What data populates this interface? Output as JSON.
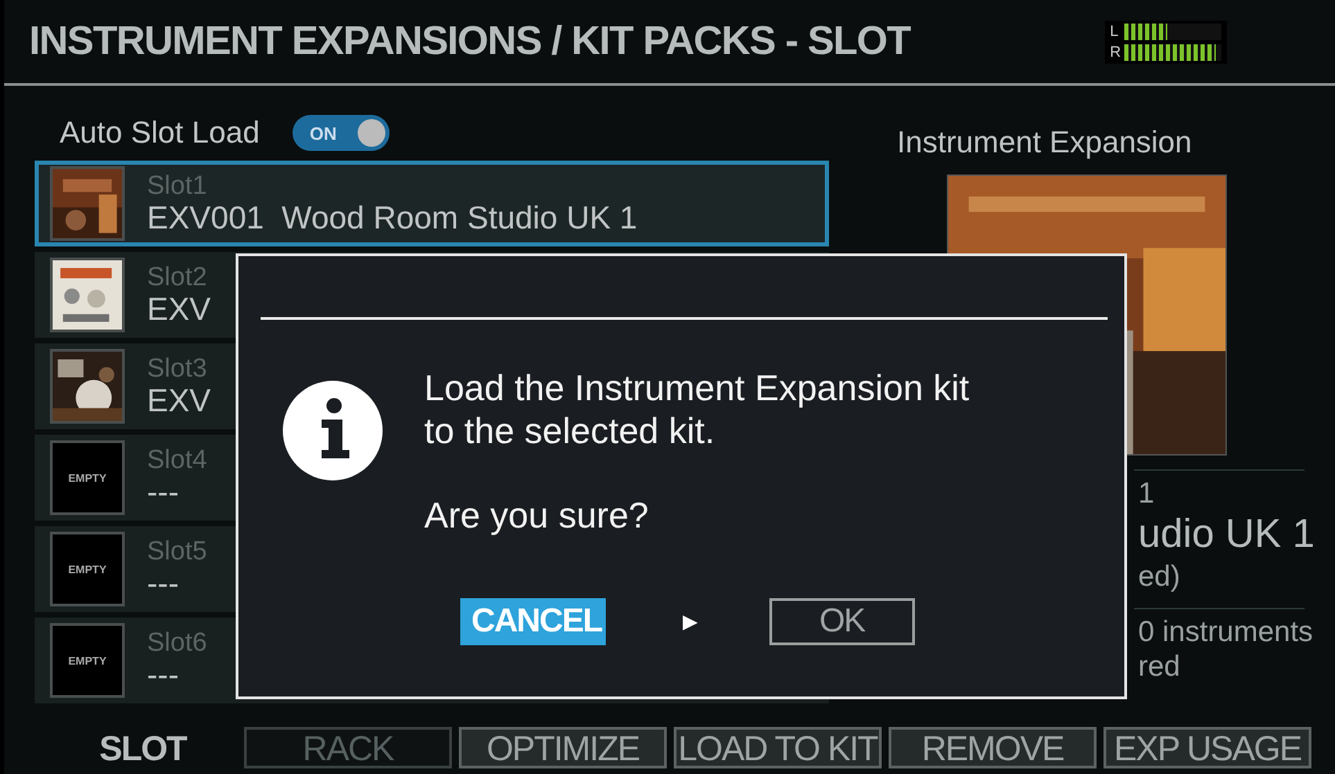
{
  "header": {
    "title": "INSTRUMENT EXPANSIONS / KIT PACKS - SLOT",
    "meters": [
      {
        "label": "L",
        "level": 0.45
      },
      {
        "label": "R",
        "level": 0.95
      }
    ]
  },
  "auto_slot_load": {
    "label": "Auto Slot Load",
    "on": true,
    "text": "ON"
  },
  "slots": [
    {
      "label": "Slot1",
      "name": "EXV001  Wood Room Studio UK 1",
      "selected": true
    },
    {
      "label": "Slot2",
      "name": "EXV",
      "selected": false
    },
    {
      "label": "Slot3",
      "name": "EXV",
      "selected": false
    },
    {
      "label": "Slot4",
      "name": "---",
      "selected": false,
      "thumb": {
        "kind": "empty",
        "text": "EMPTY"
      }
    },
    {
      "label": "Slot5",
      "name": "---",
      "selected": false,
      "thumb": {
        "kind": "empty",
        "text": "EMPTY"
      }
    },
    {
      "label": "Slot6",
      "name": "---",
      "selected": false,
      "thumb": {
        "kind": "empty",
        "text": "EMPTY"
      }
    }
  ],
  "detail": {
    "title": "Instrument Expansion",
    "lines": [
      {
        "kind": "small",
        "text": "1"
      },
      {
        "kind": "large",
        "text": "udio UK 1"
      },
      {
        "kind": "small",
        "text": "ed)"
      },
      {
        "kind": "rule"
      },
      {
        "kind": "small",
        "text": "0 instruments"
      },
      {
        "kind": "small",
        "text": "red"
      }
    ]
  },
  "tabs": [
    {
      "label": "SLOT",
      "selected": true,
      "disabled": false
    },
    {
      "label": "RACK",
      "selected": false,
      "disabled": true
    },
    {
      "label": "OPTIMIZE",
      "selected": false,
      "disabled": false
    },
    {
      "label": "LOAD TO KIT",
      "selected": false,
      "disabled": false
    },
    {
      "label": "REMOVE",
      "selected": false,
      "disabled": false
    },
    {
      "label": "EXP USAGE",
      "selected": false,
      "disabled": false
    }
  ],
  "dialog": {
    "message": "Load the Instrument Expansion kit\nto the selected kit.",
    "question": "Are you sure?",
    "buttons": [
      {
        "kind": "button",
        "label": "CANCEL",
        "selected": true
      },
      {
        "kind": "arrow",
        "label": "►"
      },
      {
        "kind": "button",
        "label": "OK",
        "selected": false
      }
    ]
  }
}
